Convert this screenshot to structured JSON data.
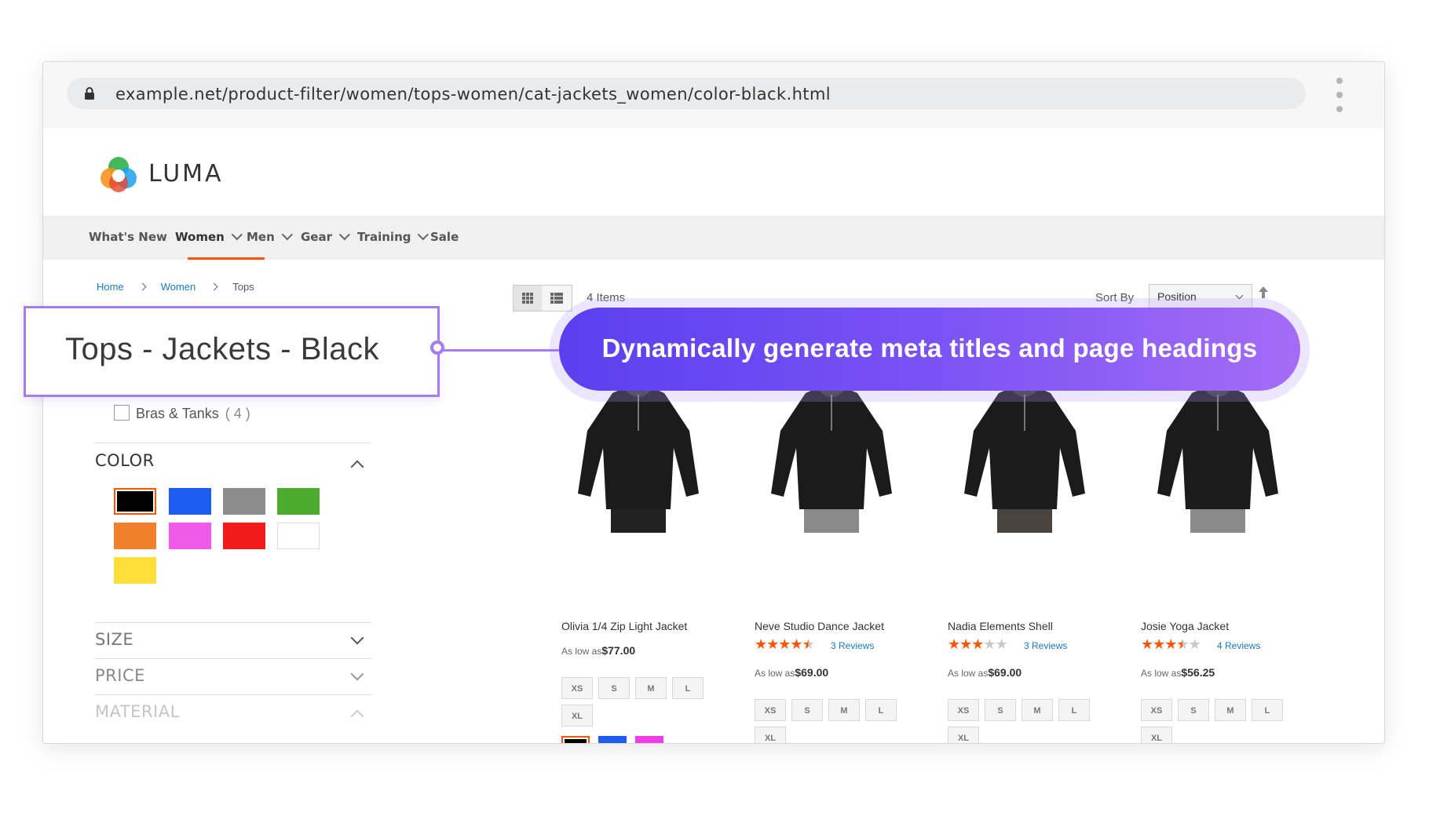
{
  "browser": {
    "url": "example.net/product-filter/women/tops-women/cat-jackets_women/color-black.html"
  },
  "brand": {
    "name": "LUMA"
  },
  "nav": [
    {
      "label": "What's New",
      "dropdown": false
    },
    {
      "label": "Women",
      "dropdown": true,
      "active": true
    },
    {
      "label": "Men",
      "dropdown": true
    },
    {
      "label": "Gear",
      "dropdown": true
    },
    {
      "label": "Training",
      "dropdown": true
    },
    {
      "label": "Sale",
      "dropdown": false
    }
  ],
  "breadcrumb": [
    "Home",
    "Women",
    "Tops"
  ],
  "toolbar": {
    "items_count": "4 Items",
    "sort_label": "Sort By",
    "sort_value": "Position"
  },
  "filters": {
    "category_option": {
      "label": "Bras & Tanks",
      "count": "( 4 )"
    },
    "color": {
      "title": "COLOR",
      "swatches": [
        "#000000",
        "#1c5cf0",
        "#8c8c8c",
        "#4caa2c",
        "#f27f2b",
        "#f15ae8",
        "#f11b1b",
        "#ffffff",
        "#ffde3c"
      ],
      "selected_index": 0
    },
    "size_title": "SIZE",
    "price_title": "PRICE",
    "material_title": "MATERIAL"
  },
  "products": [
    {
      "name": "Olivia 1/4 Zip Light Jacket",
      "as_low_as": "As low as",
      "price": "$77.00",
      "rating": 0,
      "reviews": "",
      "sizes": [
        "XS",
        "S",
        "M",
        "L",
        "XL"
      ],
      "colors": [
        "#000000",
        "#1c5cf0",
        "#f13de8"
      ]
    },
    {
      "name": "Neve Studio Dance Jacket",
      "as_low_as": "As low as",
      "price": "$69.00",
      "rating": 4.5,
      "reviews": "3 Reviews",
      "sizes": [
        "XS",
        "S",
        "M",
        "L",
        "XL"
      ],
      "colors": [
        "#000000",
        "#1c5cf0",
        "#f07018"
      ]
    },
    {
      "name": "Nadia Elements Shell",
      "as_low_as": "As low as",
      "price": "$69.00",
      "rating": 3,
      "reviews": "3 Reviews",
      "sizes": [
        "XS",
        "S",
        "M",
        "L",
        "XL"
      ],
      "colors": [
        "#000000",
        "#f07018",
        "#ffd21e"
      ]
    },
    {
      "name": "Josie Yoga Jacket",
      "as_low_as": "As low as",
      "price": "$56.25",
      "rating": 3.5,
      "reviews": "4 Reviews",
      "sizes": [
        "XS",
        "S",
        "M",
        "L",
        "XL"
      ],
      "colors": [
        "#000000",
        "#1c5cf0",
        "#8c8c8c"
      ]
    }
  ],
  "callout": {
    "heading": "Tops - Jackets - Black",
    "banner": "Dynamically generate meta titles and page headings"
  },
  "colors": {
    "accent": "#ff5501",
    "link": "#1979c3",
    "callout_border": "#a47cf0"
  }
}
